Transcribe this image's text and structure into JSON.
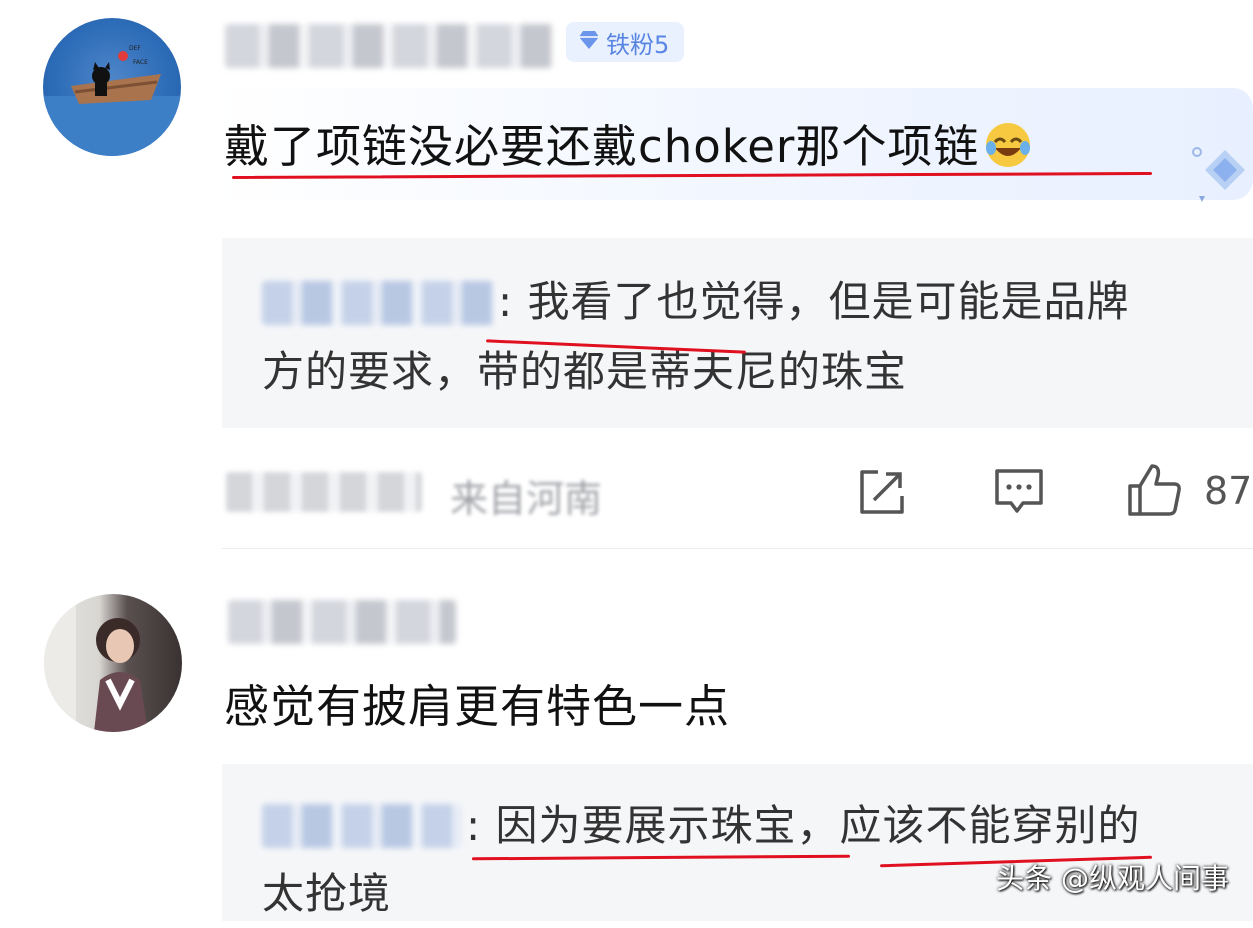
{
  "comments": [
    {
      "text": "戴了项链没必要还戴choker那个项链",
      "badge": "铁粉5",
      "reply": {
        "separator": ":",
        "text_line1": "我看了也觉得，但是可能是品牌",
        "text_line2": "方的要求，带的都是蒂夫尼的珠宝"
      },
      "location": "来自河南",
      "like_count": "87"
    },
    {
      "text": "感觉有披肩更有特色一点",
      "reply": {
        "separator": ":",
        "text_line1": "因为要展示珠宝，应该不能穿别的",
        "text_line2": "太抢境"
      }
    }
  ],
  "watermark": "头条 @纵观人间事",
  "colors": {
    "underline": "#e01020",
    "badge_text": "#5a86e3",
    "reply_bg": "#f5f6f8"
  },
  "icons": [
    "share-icon",
    "comment-icon",
    "thumbs-up-icon",
    "laugh-cry-emoji",
    "diamond-icon"
  ]
}
